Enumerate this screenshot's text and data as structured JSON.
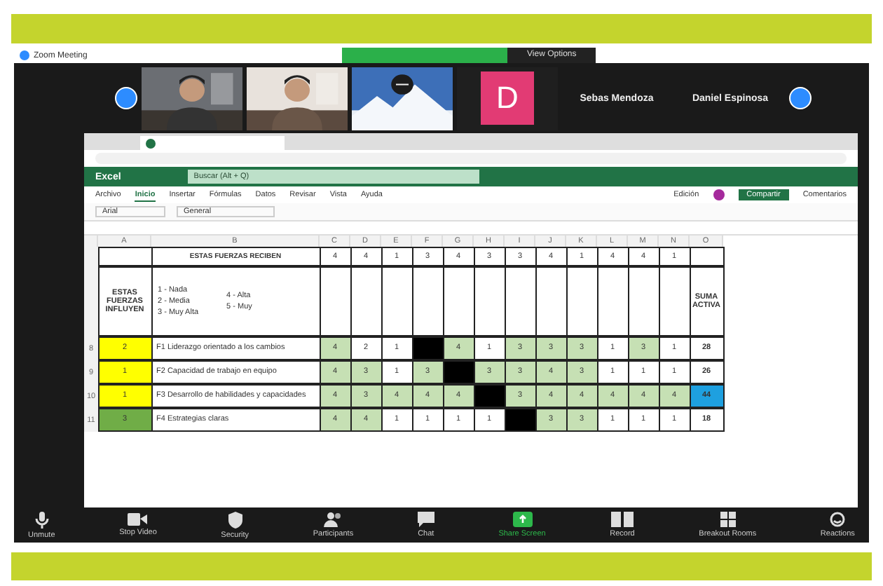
{
  "zoom": {
    "title": "Zoom Meeting",
    "view_options": "View Options",
    "tiles": [
      {
        "kind": "picture"
      },
      {
        "kind": "picture"
      },
      {
        "kind": "picture"
      },
      {
        "kind": "avatar",
        "initial": "D"
      }
    ],
    "names": [
      "Sebas Mendoza",
      "Daniel Espinosa"
    ],
    "toolbar": [
      {
        "label": "Unmute",
        "selected": false
      },
      {
        "label": "Stop Video",
        "selected": false
      },
      {
        "label": "Security",
        "selected": false
      },
      {
        "label": "Participants",
        "selected": false
      },
      {
        "label": "Chat",
        "selected": false
      },
      {
        "label": "Share Screen",
        "selected": true
      },
      {
        "label": "Record",
        "selected": false
      },
      {
        "label": "Breakout Rooms",
        "selected": false
      },
      {
        "label": "Reactions",
        "selected": false
      }
    ]
  },
  "excel": {
    "app": "Excel",
    "search": {
      "placeholder": "Buscar (Alt + Q)"
    },
    "editing": "Edición",
    "share": "Compartir",
    "comments": "Comentarios",
    "ribbon_tabs": [
      {
        "label": "Archivo",
        "selected": false
      },
      {
        "label": "Inicio",
        "selected": true
      },
      {
        "label": "Insertar",
        "selected": false
      },
      {
        "label": "Fórmulas",
        "selected": false
      },
      {
        "label": "Datos",
        "selected": false
      },
      {
        "label": "Revisar",
        "selected": false
      },
      {
        "label": "Vista",
        "selected": false
      },
      {
        "label": "Ayuda",
        "selected": false
      }
    ],
    "font": "Arial",
    "number_format": "General"
  },
  "sheet": {
    "columns": [
      "A",
      "B",
      "C",
      "D",
      "E",
      "F",
      "G",
      "H",
      "I",
      "J",
      "K",
      "L",
      "M",
      "N",
      "O"
    ],
    "title": "ESTAS FUERZAS RECIBEN",
    "header_values": [
      "4",
      "4",
      "1",
      "3",
      "4",
      "3",
      "3",
      "4",
      "1",
      "4",
      "4",
      "1"
    ],
    "left_title": "ESTAS FUERZAS INFLUYEN",
    "legend": [
      "1 - Nada",
      "2 - Media",
      "3 - Muy Alta"
    ],
    "legend_right": [
      "4 - Alta",
      "5 - Muy"
    ],
    "total_title": "SUMA ACTIVA",
    "rows": [
      {
        "num": "8",
        "cells": [
          {
            "v": "2",
            "kind": "code",
            "color": "#ffff00"
          },
          {
            "v": "F1 Liderazgo orientado a los cambios",
            "kind": "label"
          },
          {
            "v": "4",
            "kind": "filled"
          },
          {
            "v": "2",
            "kind": "plain"
          },
          {
            "v": "1",
            "kind": "plain"
          },
          {
            "kind": "diagonal"
          },
          {
            "v": "4",
            "kind": "filled"
          },
          {
            "v": "1",
            "kind": "plain"
          },
          {
            "v": "3",
            "kind": "filled"
          },
          {
            "v": "3",
            "kind": "filled"
          },
          {
            "v": "3",
            "kind": "filled"
          },
          {
            "v": "1",
            "kind": "plain"
          },
          {
            "v": "3",
            "kind": "filled"
          },
          {
            "v": "1",
            "kind": "plain"
          },
          {
            "v": "28",
            "kind": "total"
          }
        ]
      },
      {
        "num": "9",
        "cells": [
          {
            "v": "1",
            "kind": "code",
            "color": "#ffff00"
          },
          {
            "v": "F2 Capacidad de trabajo en equipo",
            "kind": "label"
          },
          {
            "v": "4",
            "kind": "filled"
          },
          {
            "v": "3",
            "kind": "filled"
          },
          {
            "v": "1",
            "kind": "plain"
          },
          {
            "v": "3",
            "kind": "filled"
          },
          {
            "kind": "diagonal"
          },
          {
            "v": "3",
            "kind": "filled"
          },
          {
            "v": "3",
            "kind": "filled"
          },
          {
            "v": "4",
            "kind": "filled"
          },
          {
            "v": "3",
            "kind": "filled"
          },
          {
            "v": "1",
            "kind": "plain"
          },
          {
            "v": "1",
            "kind": "plain"
          },
          {
            "v": "1",
            "kind": "plain"
          },
          {
            "v": "26",
            "kind": "total"
          }
        ]
      },
      {
        "num": "10",
        "cells": [
          {
            "v": "1",
            "kind": "code",
            "color": "#ffff00"
          },
          {
            "v": "F3 Desarrollo de habilidades y capacidades",
            "kind": "label"
          },
          {
            "v": "4",
            "kind": "filled"
          },
          {
            "v": "3",
            "kind": "filled"
          },
          {
            "v": "4",
            "kind": "filled"
          },
          {
            "v": "4",
            "kind": "filled"
          },
          {
            "v": "4",
            "kind": "filled"
          },
          {
            "kind": "diagonal"
          },
          {
            "v": "3",
            "kind": "filled"
          },
          {
            "v": "4",
            "kind": "filled"
          },
          {
            "v": "4",
            "kind": "filled"
          },
          {
            "v": "4",
            "kind": "filled"
          },
          {
            "v": "4",
            "kind": "filled"
          },
          {
            "v": "4",
            "kind": "filled"
          },
          {
            "v": "44",
            "kind": "highlight"
          }
        ]
      },
      {
        "num": "11",
        "cells": [
          {
            "v": "3",
            "kind": "code",
            "color": "#70ad47"
          },
          {
            "v": "F4 Estrategias claras",
            "kind": "label"
          },
          {
            "v": "4",
            "kind": "filled"
          },
          {
            "v": "4",
            "kind": "filled"
          },
          {
            "v": "1",
            "kind": "plain"
          },
          {
            "v": "1",
            "kind": "plain"
          },
          {
            "v": "1",
            "kind": "plain"
          },
          {
            "v": "1",
            "kind": "plain"
          },
          {
            "kind": "diagonal"
          },
          {
            "v": "3",
            "kind": "filled"
          },
          {
            "v": "3",
            "kind": "filled"
          },
          {
            "v": "1",
            "kind": "plain"
          },
          {
            "v": "1",
            "kind": "plain"
          },
          {
            "v": "1",
            "kind": "plain"
          },
          {
            "v": "18",
            "kind": "total"
          }
        ]
      }
    ]
  }
}
